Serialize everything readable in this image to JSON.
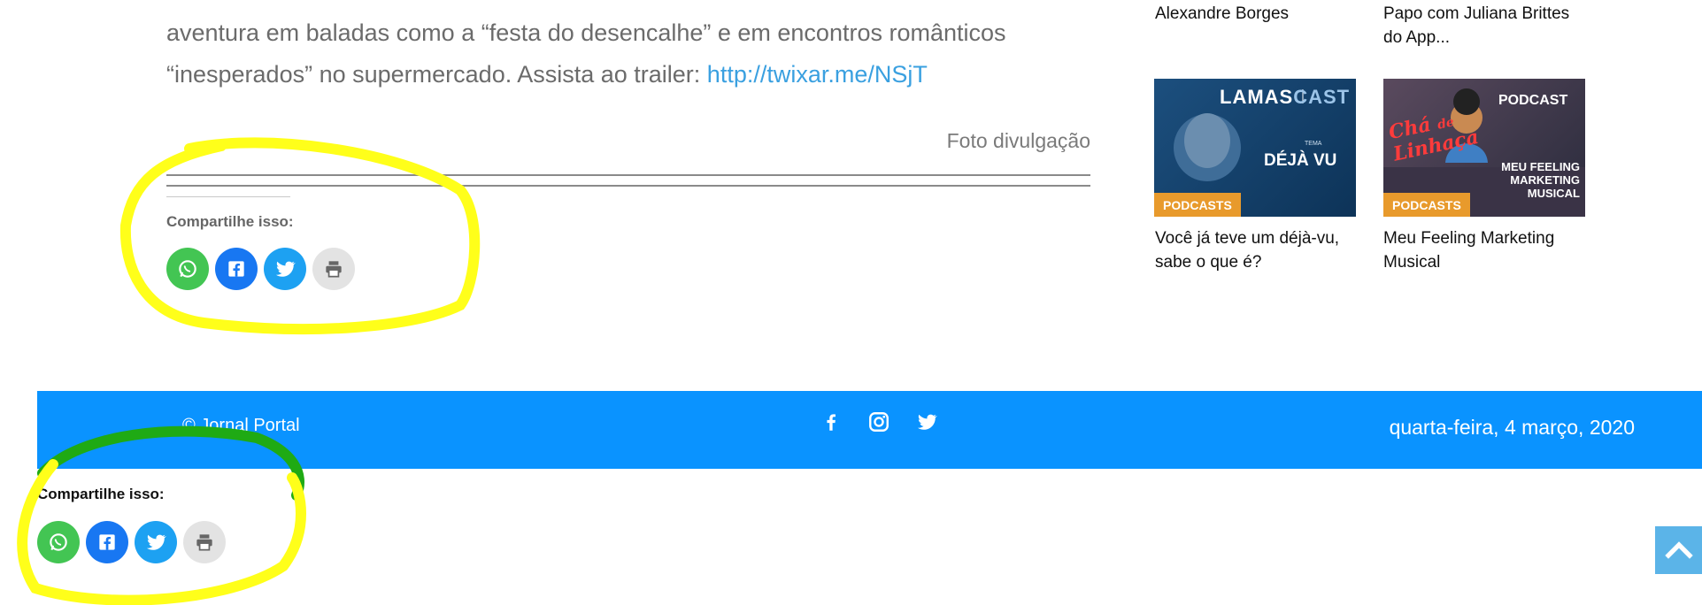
{
  "article": {
    "line1": "aventura em baladas como a “festa do desencalhe” e em encontros românticos",
    "line2_prefix": "“inesperados” no supermercado. Assista ao trailer: ",
    "trailer_link": "http://twixar.me/NSjT",
    "caption": "Foto divulgação"
  },
  "share": {
    "title": "Compartilhe isso:",
    "buttons": [
      {
        "name": "whatsapp",
        "icon": "whatsapp-icon",
        "color": "#43c553"
      },
      {
        "name": "facebook",
        "icon": "facebook-icon",
        "color": "#1877f2"
      },
      {
        "name": "twitter",
        "icon": "twitter-icon",
        "color": "#1da1f2"
      },
      {
        "name": "print",
        "icon": "print-icon",
        "color": "#e3e3e3"
      }
    ]
  },
  "sidebar": {
    "top_titles": [
      "Alexandre Borges",
      "Papo com Juliana Brittes do App..."
    ],
    "cards": [
      {
        "badge": "PODCASTS",
        "title": "Você já teve um déjà-vu, sabe o que é?",
        "thumb_brand_a": "LAMAS",
        "thumb_brand_b": "CAST",
        "thumb_tema": "TEMA",
        "thumb_text": "DÉJÀ VU"
      },
      {
        "badge": "PODCASTS",
        "title": "Meu Feeling Marketing Musical",
        "thumb_label": "PODCAST",
        "thumb_logo_a": "Chá",
        "thumb_logo_b": "de",
        "thumb_logo_c": "Linhaça",
        "thumb_text_1": "MEU FEELING",
        "thumb_text_2": "MARKETING",
        "thumb_text_3": "MUSICAL"
      }
    ]
  },
  "footer": {
    "copyright": "© Jornal Portal",
    "date": "quarta-feira, 4 março, 2020",
    "social": [
      "facebook-icon",
      "instagram-icon",
      "twitter-icon"
    ]
  },
  "colors": {
    "footer_bg": "#0a93ff",
    "highlight_yellow": "#ffff1a",
    "highlight_green": "#1faa14",
    "badge": "#e89a2c",
    "link": "#3aa0e0"
  }
}
